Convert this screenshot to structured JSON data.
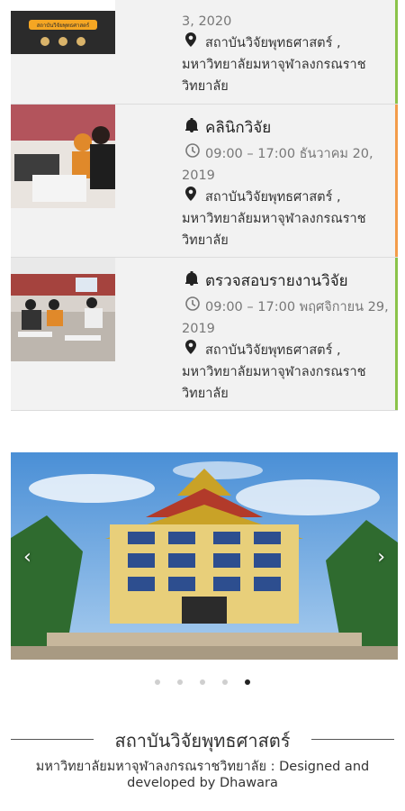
{
  "events": [
    {
      "date_text": "3, 2020",
      "location": "สถาบันวิจัยพุทธศาสตร์ , มหาวิทยาลัยมหาจุฬาลงกรณราชวิทยาลัย",
      "accent": "#8bc34a",
      "thumb_label": "สถาบันวิจัยพุทธศาสตร์"
    },
    {
      "title": "คลินิกวิจัย",
      "time_text": "09:00 – 17:00 ธันวาคม 20, 2019",
      "location": "สถาบันวิจัยพุทธศาสตร์ , มหาวิทยาลัยมหาจุฬาลงกรณราชวิทยาลัย",
      "accent": "#f39c4a"
    },
    {
      "title": "ตรวจสอบรายงานวิจัย",
      "time_text": "09:00 – 17:00 พฤศจิกายน 29, 2019",
      "location": "สถาบันวิจัยพุทธศาสตร์ , มหาวิทยาลัยมหาจุฬาลงกรณราชวิทยาลัย",
      "accent": "#8bc34a"
    }
  ],
  "carousel": {
    "dot_count": 5,
    "active_index": 4
  },
  "footer": {
    "title": "สถาบันวิจัยพุทธศาสตร์",
    "subtitle": "มหาวิทยาลัยมหาจุฬาลงกรณราชวิทยาลัย : Designed and developed by Dhawara"
  },
  "icons": {
    "location": "map-pin-icon",
    "event": "bell-icon",
    "time": "clock-icon"
  }
}
